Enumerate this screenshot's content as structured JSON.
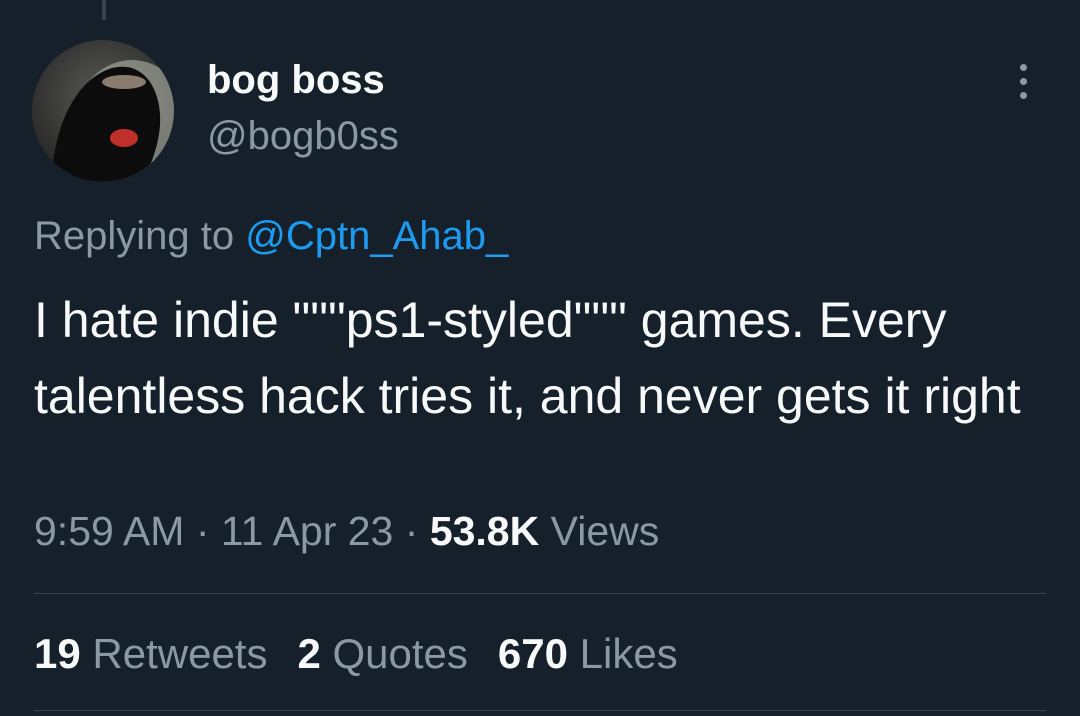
{
  "author": {
    "display_name": "bog boss",
    "handle": "@bogb0ss"
  },
  "reply": {
    "prefix": "Replying to ",
    "to_handle": "@Cptn_Ahab_"
  },
  "tweet": {
    "text": "I hate indie \"\"\"ps1-styled\"\"\" games. Every talentless hack tries it, and never gets it right"
  },
  "meta": {
    "time": "9:59 AM",
    "separator": " · ",
    "date": "11 Apr 23",
    "views_count": "53.8K",
    "views_label": "Views"
  },
  "stats": {
    "retweets_count": "19",
    "retweets_label": "Retweets",
    "quotes_count": "2",
    "quotes_label": "Quotes",
    "likes_count": "670",
    "likes_label": "Likes"
  },
  "icons": {
    "more": "more-horizontal-icon"
  },
  "colors": {
    "background": "#15202b",
    "text_primary": "#f7f9f9",
    "text_secondary": "#8b98a5",
    "link": "#1d9bf0",
    "divider": "#38444d"
  }
}
